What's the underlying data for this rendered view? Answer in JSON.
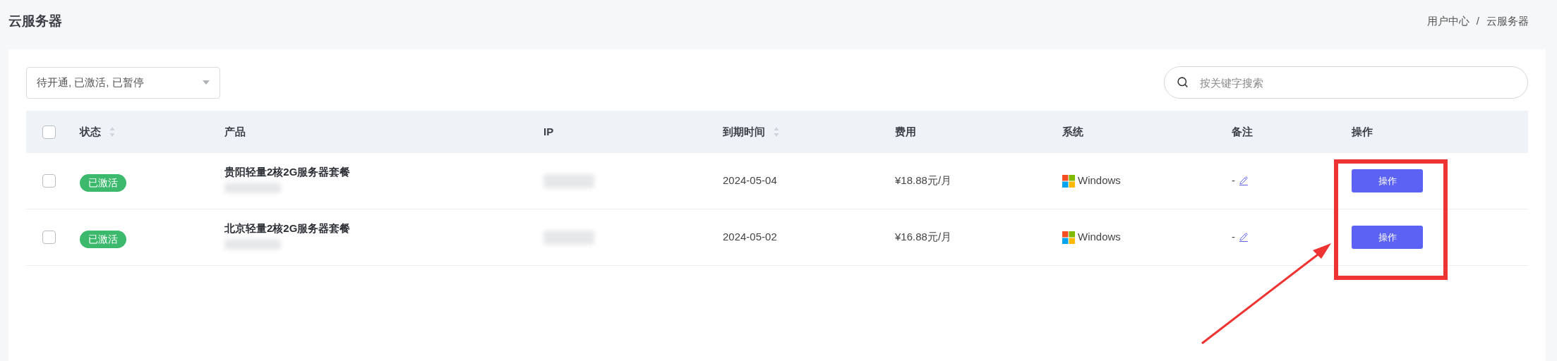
{
  "page": {
    "title": "云服务器",
    "breadcrumb": {
      "items": [
        "用户中心",
        "云服务器"
      ],
      "separator": "/"
    }
  },
  "filter": {
    "value": "待开通, 已激活, 已暂停"
  },
  "search": {
    "placeholder": "按关键字搜索"
  },
  "table": {
    "select_all": {
      "checked": false
    },
    "columns": [
      {
        "label": "状态",
        "sortable": true
      },
      {
        "label": "产品",
        "sortable": false
      },
      {
        "label": "IP",
        "sortable": false
      },
      {
        "label": "到期时间",
        "sortable": true
      },
      {
        "label": "费用",
        "sortable": false
      },
      {
        "label": "系统",
        "sortable": false
      },
      {
        "label": "备注",
        "sortable": false
      },
      {
        "label": "操作",
        "sortable": false
      }
    ],
    "rows": [
      {
        "checked": false,
        "status": "已激活",
        "product": "贵阳轻量2核2G服务器套餐",
        "expiry": "2024-05-04",
        "fee": "¥18.88元/月",
        "os": "Windows",
        "note": "-",
        "action": "操作"
      },
      {
        "checked": false,
        "status": "已激活",
        "product": "北京轻量2核2G服务器套餐",
        "expiry": "2024-05-02",
        "fee": "¥16.88元/月",
        "os": "Windows",
        "note": "-",
        "action": "操作"
      }
    ]
  }
}
